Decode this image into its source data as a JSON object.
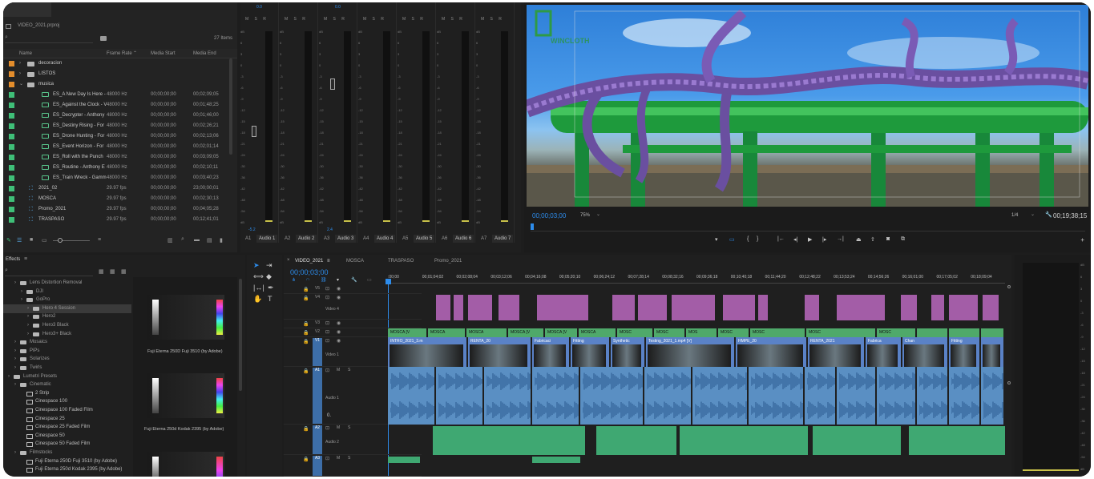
{
  "project": {
    "title": "VIDEO_2021.prproj",
    "item_count": "27 Items",
    "columns": [
      "Name",
      "Frame Rate",
      "Media Start",
      "Media End"
    ],
    "rows": [
      {
        "kind": "folder",
        "color": "#e38d2c",
        "name": "decoracion",
        "indent": 1,
        "expanded": false,
        "fr": "",
        "ms": "",
        "me": ""
      },
      {
        "kind": "folder",
        "color": "#e38d2c",
        "name": "LISTOS",
        "indent": 1,
        "expanded": false,
        "fr": "",
        "ms": "",
        "me": ""
      },
      {
        "kind": "folder",
        "color": "#e38d2c",
        "name": "musica",
        "indent": 1,
        "expanded": true,
        "fr": "",
        "ms": "",
        "me": ""
      },
      {
        "kind": "audio",
        "color": "#3fbf78",
        "name": "ES_A New Day Is Here -",
        "indent": 2,
        "fr": "48000 Hz",
        "ms": "00;00;00;00",
        "me": "00;02;09;05"
      },
      {
        "kind": "audio",
        "color": "#3fbf78",
        "name": "ES_Against the Clock - V",
        "indent": 2,
        "fr": "48000 Hz",
        "ms": "00;00;00;00",
        "me": "00;01;48;25"
      },
      {
        "kind": "audio",
        "color": "#3fbf78",
        "name": "ES_Decrypter - Anthony",
        "indent": 2,
        "fr": "48000 Hz",
        "ms": "00;00;00;00",
        "me": "00;01;46;00"
      },
      {
        "kind": "audio",
        "color": "#3fbf78",
        "name": "ES_Destiny Rising - For",
        "indent": 2,
        "fr": "48000 Hz",
        "ms": "00;00;00;00",
        "me": "00;02;26;21"
      },
      {
        "kind": "audio",
        "color": "#3fbf78",
        "name": "ES_Drone Hunting - For",
        "indent": 2,
        "fr": "48000 Hz",
        "ms": "00;00;00;00",
        "me": "00;02;13;06"
      },
      {
        "kind": "audio",
        "color": "#3fbf78",
        "name": "ES_Event Horizon - For",
        "indent": 2,
        "fr": "48000 Hz",
        "ms": "00;00;00;00",
        "me": "00;02;01;14"
      },
      {
        "kind": "audio",
        "color": "#3fbf78",
        "name": "ES_Roll with the Punch",
        "indent": 2,
        "fr": "48000 Hz",
        "ms": "00;00;00;00",
        "me": "00;03;09;05"
      },
      {
        "kind": "audio",
        "color": "#3fbf78",
        "name": "ES_Routine - Anthony E",
        "indent": 2,
        "fr": "48000 Hz",
        "ms": "00;00;00;00",
        "me": "00;02;10;11"
      },
      {
        "kind": "audio",
        "color": "#3fbf78",
        "name": "ES_Train Wreck - Gamm",
        "indent": 2,
        "fr": "48000 Hz",
        "ms": "00;00;00;00",
        "me": "00;03;40;23"
      },
      {
        "kind": "seq",
        "color": "#3fbf78",
        "name": "2021_02",
        "indent": 1,
        "fr": "29.97 fps",
        "ms": "00;00;00;00",
        "me": "23;00;00;01"
      },
      {
        "kind": "seq",
        "color": "#3fbf78",
        "name": "MOSCA",
        "indent": 1,
        "fr": "29.97 fps",
        "ms": "00;00;00;00",
        "me": "00;02;30;13"
      },
      {
        "kind": "seq",
        "color": "#3fbf78",
        "name": "Promo_2021",
        "indent": 1,
        "fr": "29.97 fps",
        "ms": "00;00;00;00",
        "me": "00;04;05;28"
      },
      {
        "kind": "seq",
        "color": "#3fbf78",
        "name": "TRASPASO",
        "indent": 1,
        "fr": "29.97 fps",
        "ms": "00;00;00;00",
        "me": "00;12;41;01"
      }
    ]
  },
  "mixer": {
    "top_values": [
      "0.0",
      "",
      "0.0",
      "",
      "",
      "",
      ""
    ],
    "msr": "M S R",
    "scale": [
      "dB",
      "6",
      "3",
      "0",
      "-3",
      "-6",
      "-9",
      "-12",
      "-15",
      "-18",
      "-21",
      "-24",
      "-30",
      "-36",
      "-42",
      "-48",
      "-54",
      "dB"
    ],
    "bottom_values": [
      "-5.2",
      "",
      "2.4",
      "",
      "",
      "",
      ""
    ],
    "fader_levels": [
      0.53,
      0,
      0.28,
      0,
      0,
      0,
      0
    ],
    "channels": [
      {
        "id": "A1",
        "name": "Audio 1"
      },
      {
        "id": "A2",
        "name": "Audio 2"
      },
      {
        "id": "A3",
        "name": "Audio 3"
      },
      {
        "id": "A4",
        "name": "Audio 4"
      },
      {
        "id": "A5",
        "name": "Audio 5"
      },
      {
        "id": "A6",
        "name": "Audio 6"
      },
      {
        "id": "A7",
        "name": "Audio 7"
      }
    ]
  },
  "program": {
    "timecode": "00;00;03;00",
    "zoom": "75%",
    "resolution": "1/4",
    "duration": "00;19;38;15",
    "watermark": "WINCLOTH"
  },
  "effects": {
    "title": "Effects",
    "items": [
      {
        "label": "Lens Distortion Removal",
        "indent": 1,
        "type": "folder"
      },
      {
        "label": "DJI",
        "indent": 2,
        "type": "folder"
      },
      {
        "label": "GoPro",
        "indent": 2,
        "type": "folder"
      },
      {
        "label": "Hero 4 Session",
        "indent": 3,
        "type": "folder",
        "selected": true
      },
      {
        "label": "Hero2",
        "indent": 3,
        "type": "folder"
      },
      {
        "label": "Hero3 Black",
        "indent": 3,
        "type": "folder"
      },
      {
        "label": "Hero3+ Black",
        "indent": 3,
        "type": "folder"
      },
      {
        "label": "Mosaics",
        "indent": 1,
        "type": "folder"
      },
      {
        "label": "PiPs",
        "indent": 1,
        "type": "folder"
      },
      {
        "label": "Solarizes",
        "indent": 1,
        "type": "folder"
      },
      {
        "label": "Twirls",
        "indent": 1,
        "type": "folder"
      },
      {
        "label": "Lumetri Presets",
        "indent": 0,
        "type": "folder"
      },
      {
        "label": "Cinematic",
        "indent": 1,
        "type": "folder"
      },
      {
        "label": "2 Strip",
        "indent": 2,
        "type": "preset"
      },
      {
        "label": "Cinespace 100",
        "indent": 2,
        "type": "preset"
      },
      {
        "label": "Cinespace 100 Faded Film",
        "indent": 2,
        "type": "preset"
      },
      {
        "label": "Cinespace 25",
        "indent": 2,
        "type": "preset"
      },
      {
        "label": "Cinespace 25 Faded Film",
        "indent": 2,
        "type": "preset"
      },
      {
        "label": "Cinespace 50",
        "indent": 2,
        "type": "preset"
      },
      {
        "label": "Cinespace 50 Faded Film",
        "indent": 2,
        "type": "preset"
      },
      {
        "label": "Filmstocks",
        "indent": 1,
        "type": "folder"
      },
      {
        "label": "Fuji Eterna 250D Fuji 3510 (by Adobe)",
        "indent": 2,
        "type": "preset"
      },
      {
        "label": "Fuji Eterna 250d Kodak 2395 (by Adobe)",
        "indent": 2,
        "type": "preset"
      }
    ],
    "previews": [
      {
        "label": "Fuji Eterna 250D Fuji 3510 (by Adobe)"
      },
      {
        "label": "Fuji Eterna 250d Kodak 2395 (by Adobe)"
      }
    ]
  },
  "timeline": {
    "tabs": [
      "VIDEO_2021",
      "MOSCA",
      "TRASPASO",
      "Promo_2021"
    ],
    "timecode": "00;00;03;00",
    "ruler": [
      ":00;00",
      "00;01;04;02",
      "00;02;08;04",
      "00;03;12;06",
      "00;04;16;08",
      "00;05;20;10",
      "00;06;24;12",
      "00;07;28;14",
      "00;08;32;16",
      "00;09;36;18",
      "00;10;40;18",
      "00;11;44;20",
      "00;12;48;22",
      "00;13;53;24",
      "00;14;56;26",
      "00;16;01;00",
      "00;17;05;02",
      "00;18;09;04"
    ],
    "tracks": [
      {
        "id": "V5",
        "name": ""
      },
      {
        "id": "V4",
        "name": "Video 4"
      },
      {
        "id": "V3",
        "name": ""
      },
      {
        "id": "V2",
        "name": ""
      },
      {
        "id": "V1",
        "name": "Video 1"
      },
      {
        "id": "A1",
        "name": "Audio 1"
      },
      {
        "id": "A2",
        "name": "Audio 2"
      },
      {
        "id": "A3",
        "name": ""
      }
    ],
    "a1_volume": "0.",
    "v2_clips": [
      "MOSCA [V",
      "MOSCA",
      "MOSCA",
      "MOSCA [V",
      "MOSCA [V",
      "MOSCA",
      "MOSC",
      "MOSC",
      "MOS",
      "MOSC",
      "MOSC",
      "MOSC",
      "MOSC"
    ],
    "v1_clips": [
      "INTRO_2021_3.m",
      "RENTA_20",
      "Fabricaci",
      "Fitting",
      "Synthetic",
      "Testing_2021_1.mp4 [V]",
      "HMPE_20",
      "RENTA_2021",
      "Fabrica",
      "Chan",
      "Fitting"
    ]
  },
  "colors": {
    "accent": "#2d8ceb",
    "folder_orange": "#e38d2c",
    "green": "#3fbf78",
    "purple": "#a35da7"
  }
}
